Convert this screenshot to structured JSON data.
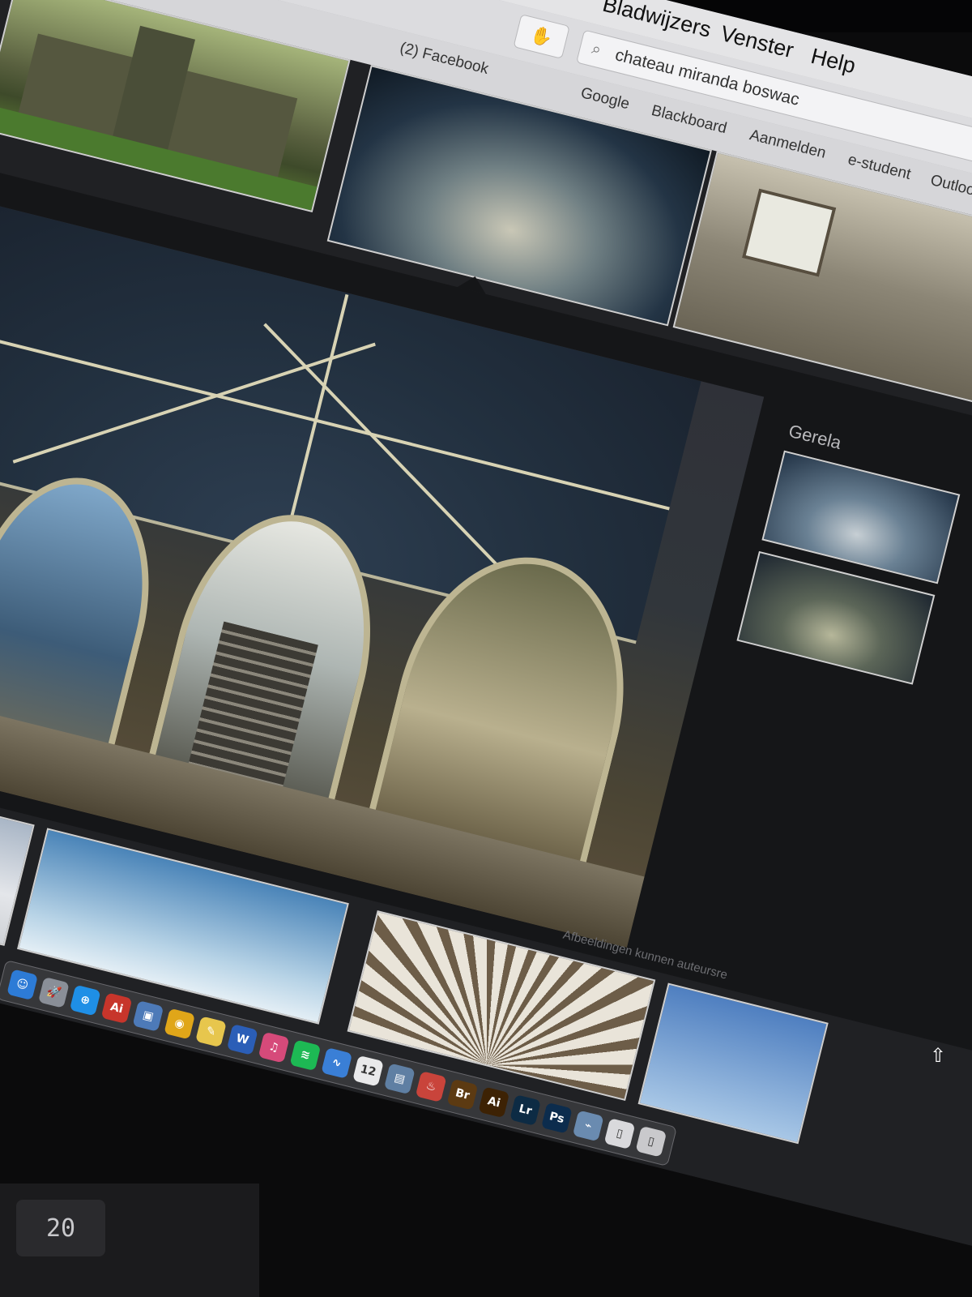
{
  "menubar": {
    "items": [
      "Bladwijzers",
      "Venster",
      "Help"
    ]
  },
  "toolbar": {
    "search_value": "chateau miranda boswac"
  },
  "tabbar": {
    "tab_label": "(2) Facebook",
    "bookmarks": [
      "Google",
      "Blackboard",
      "Aanmelden",
      "e-student",
      "Outlook"
    ]
  },
  "viewer": {
    "related_title": "Gerela",
    "copyright_notice": "Afbeeldingen kunnen auteursre"
  },
  "dock": {
    "apps": [
      {
        "name": "finder",
        "glyph": "☺",
        "color": "#2d7bd6"
      },
      {
        "name": "launchpad",
        "glyph": "🚀",
        "color": "#8a8f98"
      },
      {
        "name": "safari",
        "glyph": "⊕",
        "color": "#1f8fe6"
      },
      {
        "name": "acrobat",
        "glyph": "Ai",
        "color": "#c7352b"
      },
      {
        "name": "preview",
        "glyph": "▣",
        "color": "#4d7ab8"
      },
      {
        "name": "chrome",
        "glyph": "◉",
        "color": "#e0a619"
      },
      {
        "name": "notes",
        "glyph": "✎",
        "color": "#e7c64d"
      },
      {
        "name": "word",
        "glyph": "W",
        "color": "#2b5eb7"
      },
      {
        "name": "itunes",
        "glyph": "♫",
        "color": "#d64a7a"
      },
      {
        "name": "spotify",
        "glyph": "≋",
        "color": "#1db954"
      },
      {
        "name": "audio",
        "glyph": "∿",
        "color": "#3a7fd6"
      },
      {
        "name": "calendar",
        "glyph": "12",
        "color": "#e9e9ea"
      },
      {
        "name": "photos",
        "glyph": "▤",
        "color": "#5f7fa3"
      },
      {
        "name": "popcorn",
        "glyph": "♨",
        "color": "#c9443b"
      },
      {
        "name": "bridge",
        "glyph": "Br",
        "color": "#5c3a12"
      },
      {
        "name": "illustrator",
        "glyph": "Ai",
        "color": "#3d2204"
      },
      {
        "name": "lightroom",
        "glyph": "Lr",
        "color": "#0d2b44"
      },
      {
        "name": "photoshop",
        "glyph": "Ps",
        "color": "#0c2c4d"
      },
      {
        "name": "downloads",
        "glyph": "⌁",
        "color": "#6a8bb0"
      },
      {
        "name": "documents",
        "glyph": "▯",
        "color": "#d9d9dc"
      },
      {
        "name": "trash",
        "glyph": "▯",
        "color": "#c9c9cc"
      }
    ]
  },
  "keyboard": {
    "key_label": "20"
  }
}
